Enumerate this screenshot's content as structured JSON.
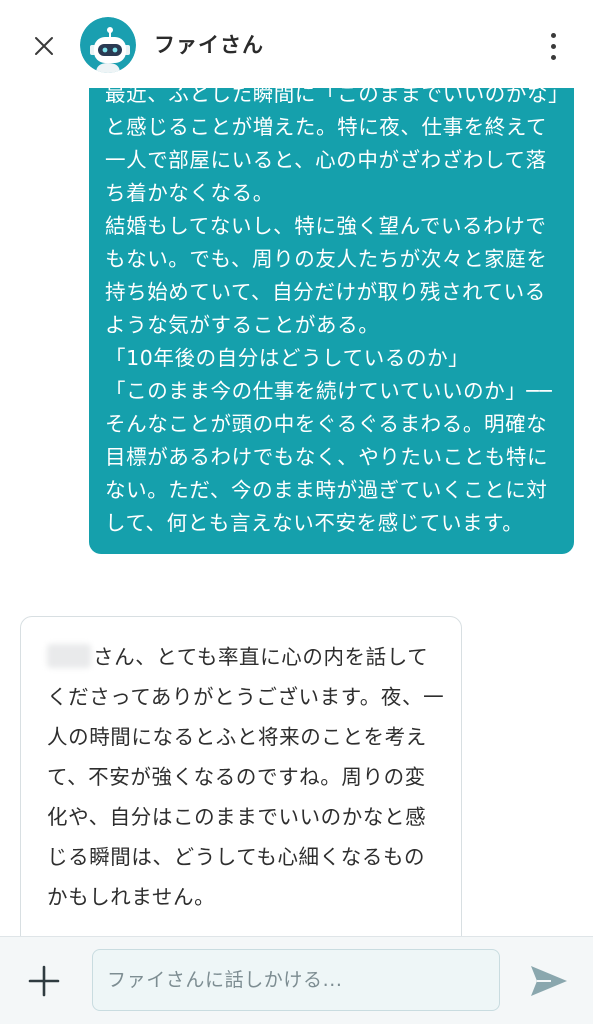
{
  "header": {
    "title": "ファイさん"
  },
  "messages": {
    "user_message": "最近、ふとした瞬間に「このままでいいのかな」と感じることが増えた。特に夜、仕事を終えて一人で部屋にいると、心の中がざわざわして落ち着かなくなる。\n結婚もしてないし、特に強く望んでいるわけでもない。でも、周りの友人たちが次々と家庭を持ち始めていて、自分だけが取り残されているような気がすることがある。\n「10年後の自分はどうしているのか」\n「このまま今の仕事を続けていていいのか」──そんなことが頭の中をぐるぐるまわる。明確な目標があるわけでもなく、やりたいことも特にない。ただ、今のまま時が過ぎていくことに対して、何とも言えない不安を感じています。",
    "bot_message": "さん、とても率直に心の内を話してくださってありがとうございます。夜、一人の時間になるとふと将来のことを考えて、不安が強くなるのですね。周りの変化や、自分はこのままでいいのかなと感じる瞬間は、どうしても心細くなるものかもしれません。"
  },
  "composer": {
    "placeholder": "ファイさんに話しかける..."
  },
  "icons": {
    "close": "close-icon",
    "avatar": "robot-avatar",
    "more": "more-vertical-icon",
    "plus": "plus-icon",
    "send": "send-icon"
  },
  "colors": {
    "user_bubble": "#15a0ac",
    "avatar_bg": "#1a9fb0",
    "send_icon": "#8aa7ae"
  }
}
